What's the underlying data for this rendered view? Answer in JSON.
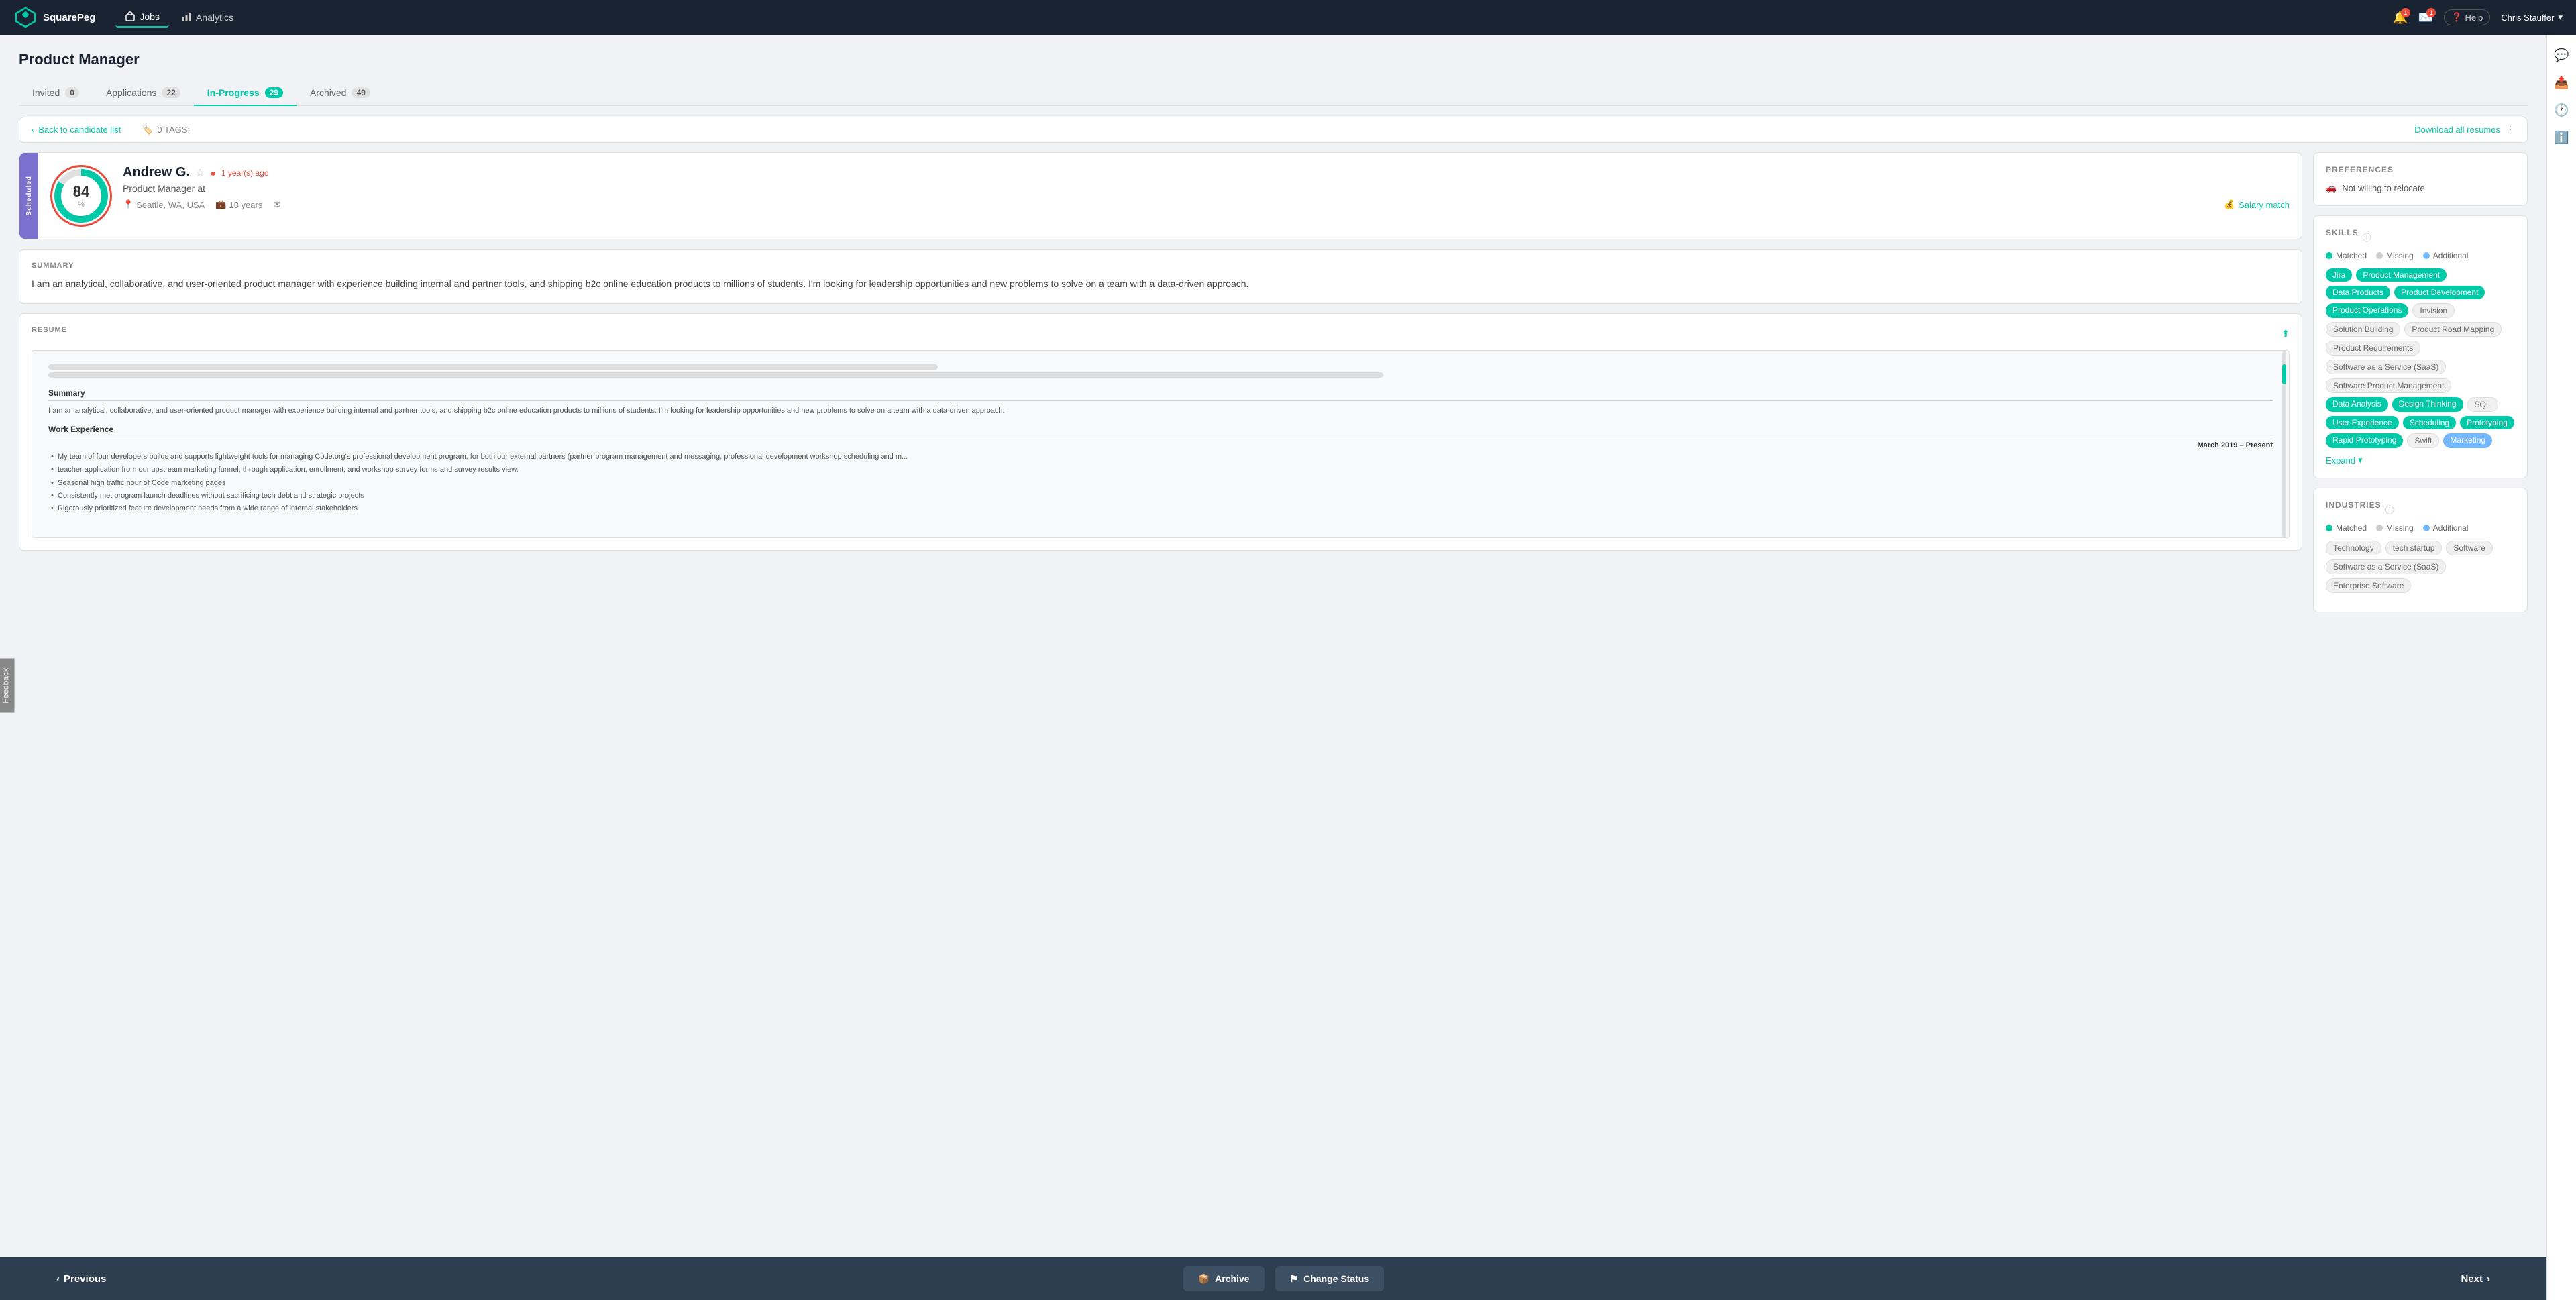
{
  "brand": {
    "name": "SquarePeg"
  },
  "nav": {
    "links": [
      {
        "id": "jobs",
        "label": "Jobs",
        "active": true
      },
      {
        "id": "analytics",
        "label": "Analytics",
        "active": false
      }
    ],
    "help_label": "Help",
    "user_name": "Chris Stauffer"
  },
  "page": {
    "title": "Product Manager"
  },
  "tabs": [
    {
      "id": "invited",
      "label": "Invited",
      "count": "0"
    },
    {
      "id": "applications",
      "label": "Applications",
      "count": "22"
    },
    {
      "id": "in_progress",
      "label": "In-Progress",
      "count": "29",
      "active": true
    },
    {
      "id": "archived",
      "label": "Archived",
      "count": "49"
    }
  ],
  "toolbar": {
    "back_label": "Back to candidate list",
    "tags_label": "0 TAGS:",
    "download_label": "Download all resumes"
  },
  "candidate": {
    "score": "84",
    "score_suffix": "%",
    "name": "Andrew G.",
    "time_ago": "1 year(s) ago",
    "role": "Product Manager at",
    "location": "Seattle, WA, USA",
    "experience": "10 years",
    "status_tag": "Scheduled",
    "salary_match": "Salary match"
  },
  "summary": {
    "label": "SUMMARY",
    "text": "I am an analytical, collaborative, and user-oriented product manager with experience building internal and partner tools, and shipping b2c online education products to millions of students. I'm looking for leadership opportunities and new problems to solve on a team with a data-driven approach."
  },
  "resume": {
    "label": "RESUME",
    "summary_title": "Summary",
    "summary_text": "I am an analytical, collaborative, and user-oriented product manager with experience building internal and partner tools, and shipping b2c online education products to millions of students. I'm looking for leadership opportunities and new problems to solve on a team with a data-driven approach.",
    "work_exp_title": "Work Experience",
    "job_date": "March 2019 – Present",
    "bullets": [
      "My team of four developers builds and supports lightweight tools for managing Code.org's professional development program, for both our external partners (partner program management and messaging, professional development workshop scheduling and m...",
      "teacher application from our upstream marketing funnel, through application, enrollment, and workshop survey forms and survey results view.",
      "Seasonal high traffic hour of Code marketing pages",
      "Consistently met program launch deadlines without sacrificing tech debt and strategic projects",
      "Rigorously prioritized feature development needs from a wide range of internal stakeholders"
    ]
  },
  "preferences": {
    "title": "PREFERENCES",
    "relocate_label": "Not willing to relocate"
  },
  "skills": {
    "title": "SKILLS",
    "legend": {
      "matched": "Matched",
      "missing": "Missing",
      "additional": "Additional"
    },
    "tags": [
      {
        "label": "Jira",
        "type": "matched"
      },
      {
        "label": "Product Management",
        "type": "matched"
      },
      {
        "label": "Data Products",
        "type": "matched"
      },
      {
        "label": "Product Development",
        "type": "matched"
      },
      {
        "label": "Product Operations",
        "type": "matched"
      },
      {
        "label": "Invision",
        "type": "missing"
      },
      {
        "label": "Solution Building",
        "type": "missing"
      },
      {
        "label": "Product Road Mapping",
        "type": "missing"
      },
      {
        "label": "Product Requirements",
        "type": "missing"
      },
      {
        "label": "Software as a Service (SaaS)",
        "type": "missing"
      },
      {
        "label": "Software Product Management",
        "type": "missing"
      },
      {
        "label": "Data Analysis",
        "type": "matched"
      },
      {
        "label": "Design Thinking",
        "type": "matched"
      },
      {
        "label": "SQL",
        "type": "missing"
      },
      {
        "label": "User Experience",
        "type": "matched"
      },
      {
        "label": "Scheduling",
        "type": "matched"
      },
      {
        "label": "Prototyping",
        "type": "matched"
      },
      {
        "label": "Rapid Prototyping",
        "type": "matched"
      },
      {
        "label": "Swift",
        "type": "missing"
      },
      {
        "label": "Marketing",
        "type": "additional"
      }
    ],
    "expand_label": "Expand"
  },
  "industries": {
    "title": "INDUSTRIES",
    "legend": {
      "matched": "Matched",
      "missing": "Missing",
      "additional": "Additional"
    },
    "tags": [
      {
        "label": "Technology",
        "type": "missing"
      },
      {
        "label": "tech startup",
        "type": "missing"
      },
      {
        "label": "Software",
        "type": "missing"
      },
      {
        "label": "Software as a Service (SaaS)",
        "type": "missing"
      },
      {
        "label": "Enterprise Software",
        "type": "missing"
      }
    ]
  },
  "bottom_nav": {
    "prev_label": "Previous",
    "archive_label": "Archive",
    "change_status_label": "Change Status",
    "next_label": "Next"
  },
  "feedback": {
    "label": "Feedback"
  }
}
